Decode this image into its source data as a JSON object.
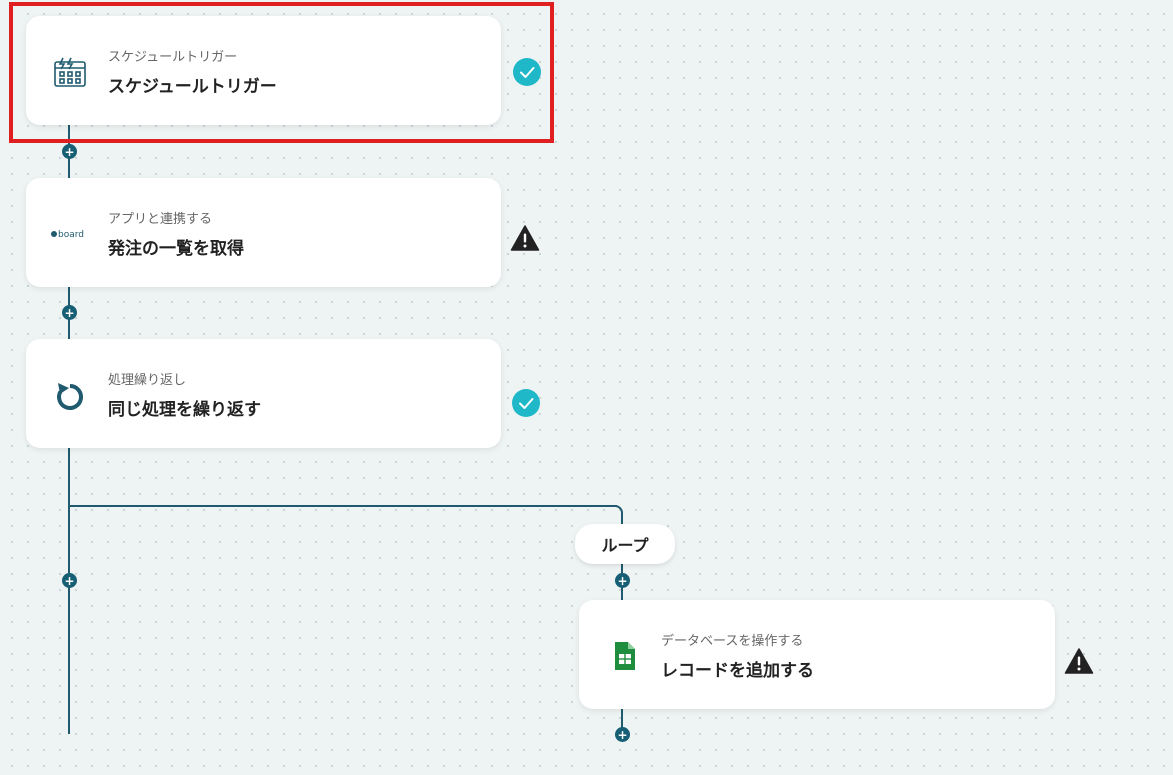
{
  "flow": {
    "steps": [
      {
        "subtitle": "スケジュールトリガー",
        "title": "スケジュールトリガー",
        "icon": "calendar-icon",
        "status": "complete"
      },
      {
        "subtitle": "アプリと連携する",
        "title": "発注の一覧を取得",
        "icon": "board-logo",
        "status": "warning"
      },
      {
        "subtitle": "処理繰り返し",
        "title": "同じ処理を繰り返す",
        "icon": "loop-icon",
        "status": "complete"
      },
      {
        "subtitle": "データベースを操作する",
        "title": "レコードを追加する",
        "icon": "google-sheets-icon",
        "status": "warning"
      }
    ],
    "loop_label": "ループ",
    "board_logo_text": "board"
  },
  "colors": {
    "line": "#1f5a6e",
    "check": "#1fb8c9",
    "warning": "#222222",
    "highlight": "#e02020",
    "sheets": "#1e8e3e"
  }
}
